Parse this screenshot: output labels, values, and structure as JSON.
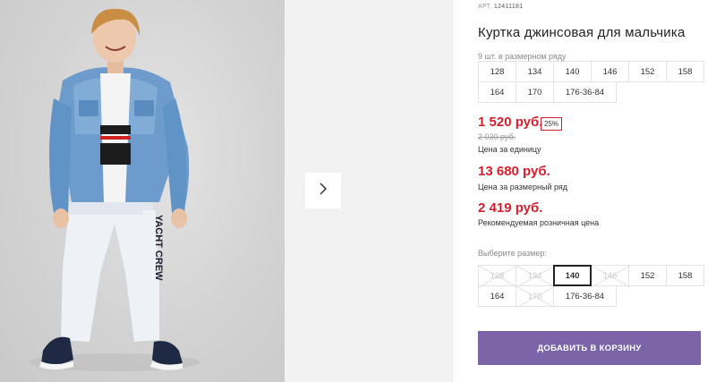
{
  "product": {
    "article_label": "АРТ.",
    "article_number": "12411181",
    "title": "Куртка джинсовая для мальчика",
    "row_count_text": "9 шт. в размерном ряду",
    "size_row": [
      "128",
      "134",
      "140",
      "146",
      "152",
      "158",
      "164",
      "170",
      "176-36-84"
    ],
    "price": "1 520 руб.",
    "discount_badge": "25%",
    "old_price": "2 030 руб.",
    "price_unit_caption": "Цена за единицу",
    "row_price": "13 680 руб.",
    "row_price_caption": "Цена за размерный ряд",
    "rrp": "2 419 руб.",
    "rrp_caption": "Рекомендуемая розничная цена",
    "choose_size_label": "Выберите размер:",
    "size_options": [
      {
        "label": "128",
        "state": "disabled"
      },
      {
        "label": "134",
        "state": "disabled"
      },
      {
        "label": "140",
        "state": "selected"
      },
      {
        "label": "146",
        "state": "disabled"
      },
      {
        "label": "152",
        "state": "available"
      },
      {
        "label": "158",
        "state": "available"
      },
      {
        "label": "164",
        "state": "available"
      },
      {
        "label": "170",
        "state": "disabled"
      },
      {
        "label": "176-36-84",
        "state": "available"
      }
    ],
    "add_to_cart_label": "ДОБАВИТЬ В КОРЗИНУ"
  },
  "gallery": {
    "next_icon": "chevron-right-icon",
    "photo_print_text": "YACHT CREW"
  },
  "colors": {
    "price_red": "#d31f2d",
    "button_purple": "#7a63a6"
  }
}
